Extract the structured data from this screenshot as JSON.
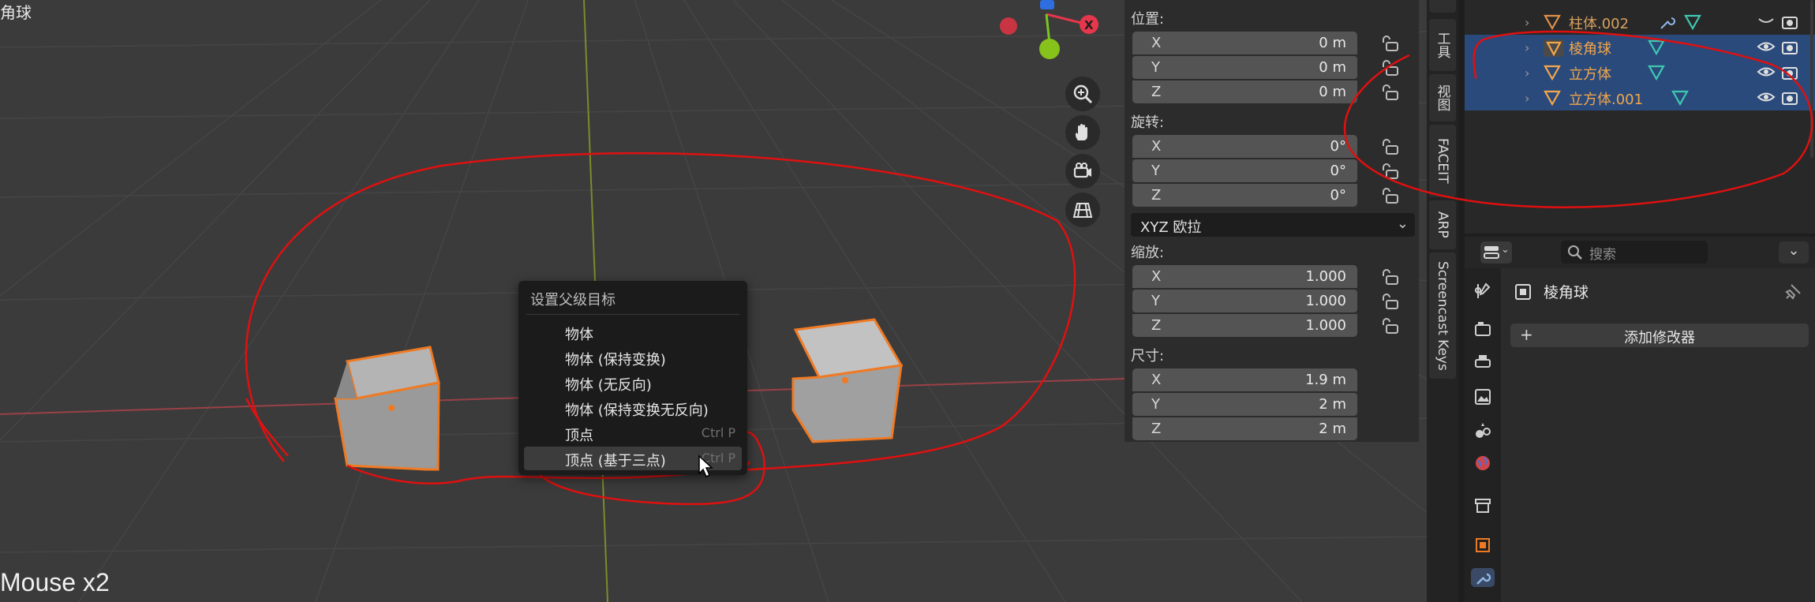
{
  "viewport": {
    "title": "角球",
    "status": "Mouse x2",
    "gizmo": {
      "x_axis": "X",
      "colors": {
        "x": "#e5364b",
        "y": "#79c720",
        "z": "#2f6ee0"
      }
    },
    "nav_icons": [
      "zoom-icon",
      "hand-pan-icon",
      "camera-icon",
      "grid-icon"
    ]
  },
  "context_menu": {
    "title": "设置父级目标",
    "items": [
      {
        "label": "物体",
        "shortcut": ""
      },
      {
        "label": "物体 (保持变换)",
        "shortcut": ""
      },
      {
        "label": "物体 (无反向)",
        "shortcut": ""
      },
      {
        "label": "物体 (保持变换无反向)",
        "shortcut": ""
      },
      {
        "label": "顶点",
        "shortcut": "Ctrl P"
      },
      {
        "label": "顶点 (基于三点)",
        "shortcut": "Ctrl P"
      }
    ]
  },
  "transform": {
    "location": {
      "label": "位置:",
      "x": "0 m",
      "y": "0 m",
      "z": "0 m"
    },
    "rotation": {
      "label": "旋转:",
      "x": "0°",
      "y": "0°",
      "z": "0°"
    },
    "rotation_mode": "XYZ 欧拉",
    "scale": {
      "label": "缩放:",
      "x": "1.000",
      "y": "1.000",
      "z": "1.000"
    },
    "dimensions": {
      "label": "尺寸:",
      "x": "1.9 m",
      "y": "2 m",
      "z": "2 m"
    },
    "axes": {
      "x": "X",
      "y": "Y",
      "z": "Z"
    }
  },
  "side_tabs": [
    "工具",
    "视图",
    "FACEIT",
    "ARP",
    "Screencast Keys"
  ],
  "outliner": {
    "rows": [
      {
        "name": "柱体.002",
        "selected": false
      },
      {
        "name": "棱角球",
        "selected": true
      },
      {
        "name": "立方体",
        "selected": true
      },
      {
        "name": "立方体.001",
        "selected": true
      }
    ]
  },
  "properties": {
    "search_placeholder": "搜索",
    "object_name": "棱角球",
    "add_modifier": "添加修改器"
  },
  "colors": {
    "selection_blue": "#2a4a7c",
    "object_orange": "#f3a64a",
    "annotation_red": "#e01010",
    "mesh_teal": "#3fc8b0"
  }
}
